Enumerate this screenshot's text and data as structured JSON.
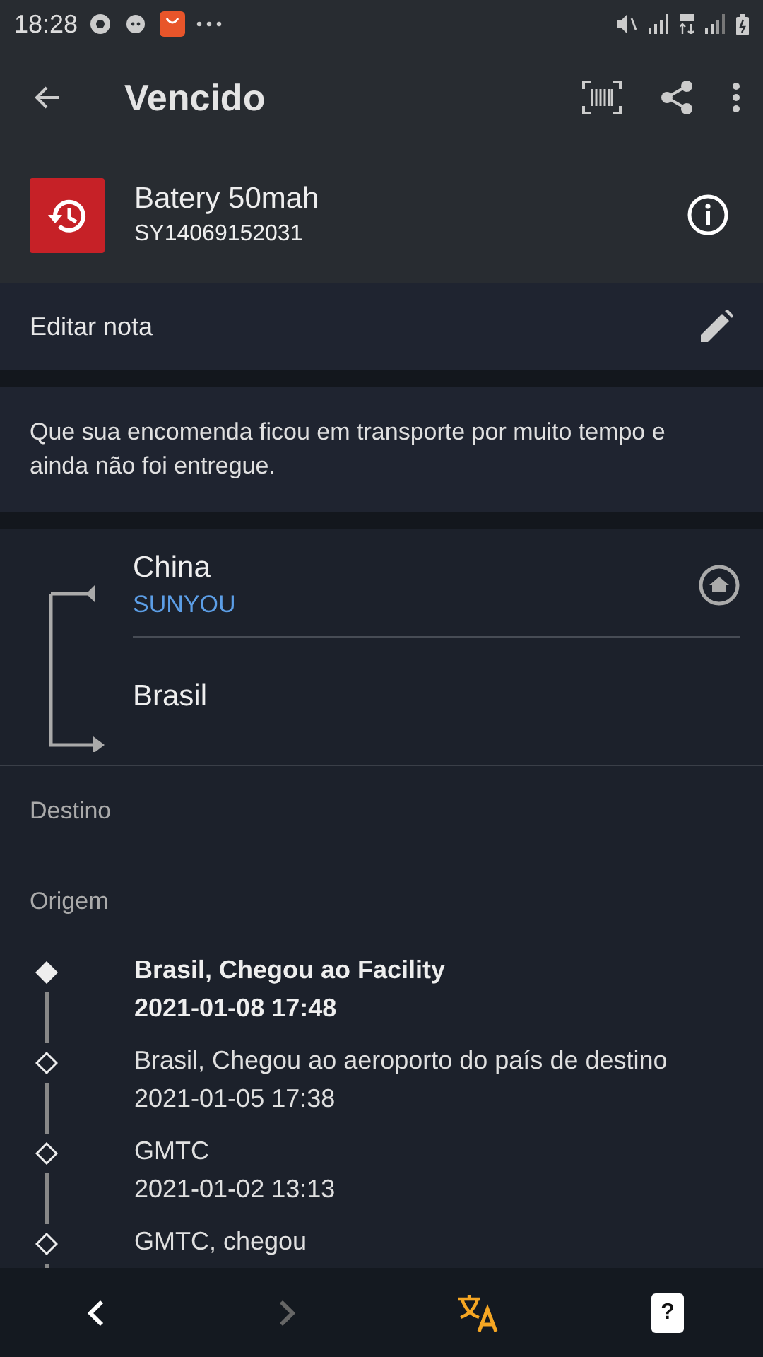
{
  "status_bar": {
    "time": "18:28"
  },
  "toolbar": {
    "title": "Vencido"
  },
  "package": {
    "name": "Batery 50mah",
    "tracking_number": "SY14069152031"
  },
  "note": {
    "label": "Editar nota"
  },
  "description": "Que sua encomenda ficou em transporte por muito tempo e ainda não foi entregue.",
  "route": {
    "origin": "China",
    "carrier": "SUNYOU",
    "destination": "Brasil"
  },
  "sections": [
    "Destino",
    "Origem"
  ],
  "events": [
    {
      "title": "Brasil, Chegou ao Facility",
      "date": "2021-01-08 17:48",
      "current": true
    },
    {
      "title": "Brasil, Chegou ao aeroporto do país de destino",
      "date": "2021-01-05 17:38",
      "current": false
    },
    {
      "title": "GMTC",
      "date": "2021-01-02 13:13",
      "current": false
    },
    {
      "title": "GMTC, chegou",
      "current": false
    }
  ],
  "bottom_nav": [
    {
      "kind": "back",
      "disabled": false
    },
    {
      "kind": "forward",
      "disabled": true
    },
    {
      "kind": "translate",
      "disabled": false
    },
    {
      "kind": "help",
      "label": "?",
      "disabled": false
    }
  ]
}
